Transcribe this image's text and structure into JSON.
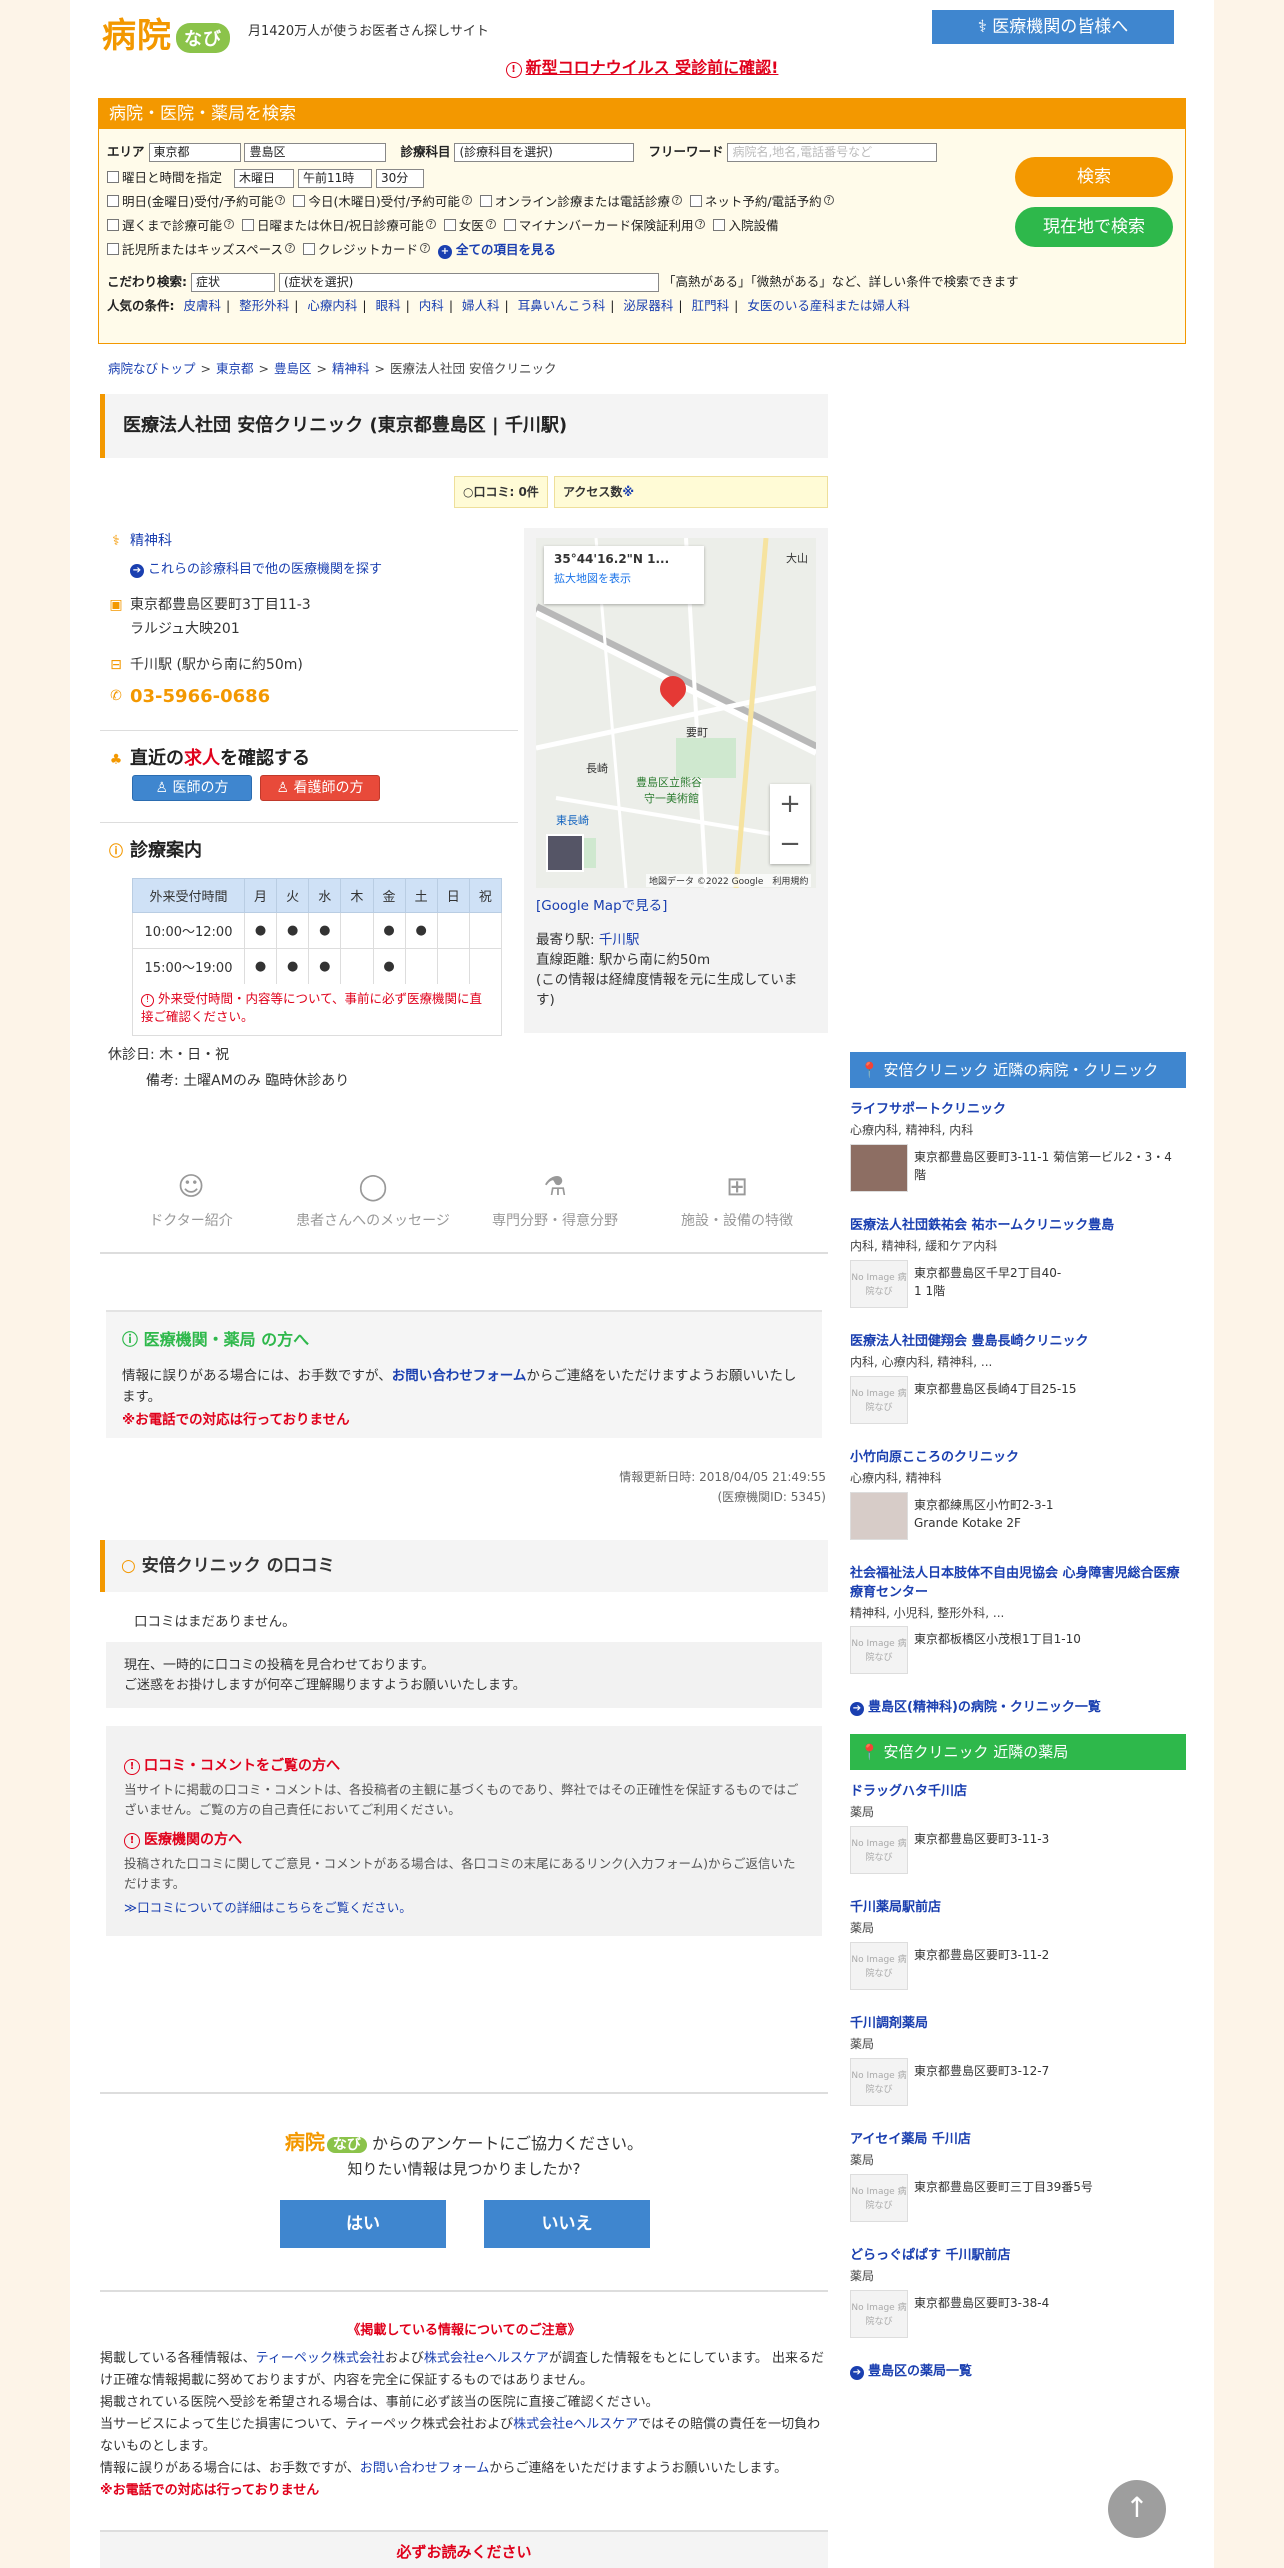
{
  "header": {
    "logo_main": "病院",
    "logo_sub": "なび",
    "tagline": "月1420万人が使うお医者さん探しサイト",
    "medical_btn": "医療機関の皆様へ",
    "covid_notice": "新型コロナウイルス 受診前に確認!"
  },
  "search": {
    "title": "病院・医院・薬局を検索",
    "area_label": "エリア",
    "pref": "東京都",
    "city": "豊島区",
    "dept_label": "診療科目",
    "dept": "(診療科目を選択)",
    "kw_label": "フリーワード",
    "kw_placeholder": "病院名,地名,電話番号など",
    "day_time_label": "曜日と時間を指定",
    "day": "木曜日",
    "hour": "午前11時",
    "minute": "30分",
    "checks": [
      "明日(金曜日)受付/予約可能",
      "今日(木曜日)受付/予約可能",
      "オンライン診療または電話診療",
      "ネット予約/電話予約",
      "遅くまで診療可能",
      "日曜または休日/祝日診療可能",
      "女医",
      "マイナンバーカード保険証利用",
      "入院設備",
      "託児所またはキッズスペース",
      "クレジットカード"
    ],
    "all_items": "全ての項目を見る",
    "kodawari_label": "こだわり検索:",
    "kodawari_type": "症状",
    "kodawari_sel": "(症状を選択)",
    "kodawari_hint": "「高熱がある」「微熱がある」など、詳しい条件で検索できます",
    "popular_label": "人気の条件:",
    "popular": [
      "皮膚科",
      "整形外科",
      "心療内科",
      "眼科",
      "内科",
      "婦人科",
      "耳鼻いんこう科",
      "泌尿器科",
      "肛門科",
      "女医のいる産科または婦人科"
    ],
    "search_btn": "検索",
    "here_btn": "現在地で検索"
  },
  "breadcrumb": [
    "病院なびトップ",
    "東京都",
    "豊島区",
    "精神科",
    "医療法人社団 安倍クリニック"
  ],
  "clinic": {
    "title": "医療法人社団 安倍クリニック (東京都豊島区 | 千川駅)",
    "reviews_badge": "口コミ: 0件",
    "access_badge": "アクセス数",
    "dept": "精神科",
    "other_link": "これらの診療科目で他の医療機関を探す",
    "address1": "東京都豊島区要町3丁目11-3",
    "address2": "ラルジュ大映201",
    "station": "千川駅 (駅から南に約50m)",
    "tel": "03-5966-0686",
    "job_pre": "直近の",
    "job_em": "求人",
    "job_post": "を確認する",
    "doctor_btn": "医師の方",
    "nurse_btn": "看護師の方",
    "schedule_title": "診療案内",
    "closed": "休診日: 木・日・祝",
    "remarks": "備考: 土曜AMのみ 臨時休診あり",
    "schedule_note": "外来受付時間・内容等について、事前に必ず医療機関に直接ご確認ください。"
  },
  "schedule": {
    "header": [
      "外来受付時間",
      "月",
      "火",
      "水",
      "木",
      "金",
      "土",
      "日",
      "祝"
    ],
    "rows": [
      [
        "10:00～12:00",
        "●",
        "●",
        "●",
        "",
        "●",
        "●",
        "",
        ""
      ],
      [
        "15:00～19:00",
        "●",
        "●",
        "●",
        "",
        "●",
        "",
        "",
        ""
      ]
    ]
  },
  "map": {
    "coord": "35°44'16.2\"N 1...",
    "enlarge": "拡大地図を表示",
    "google_link": "[Google Mapで見る]",
    "nearest_label": "最寄り駅:",
    "nearest_station": "千川駅",
    "distance": "直線距離: 駅から南に約50m",
    "disclaimer": "(この情報は経緯度情報を元に生成しています)",
    "labels": [
      "要町",
      "長崎",
      "豊島区立熊谷",
      "守一美術館",
      "東長崎",
      "大山"
    ],
    "footer": "地図データ ©2022 Google　利用規約"
  },
  "tabs": [
    "ドクター紹介",
    "患者さんへのメッセージ",
    "専門分野・得意分野",
    "施設・設備の特徴"
  ],
  "notice": {
    "title": "医療機関・薬局 の方へ",
    "text_pre": "情報に誤りがある場合には、お手数ですが、",
    "form": "お問い合わせフォーム",
    "text_post": "からご連絡をいただけますようお願いいたします。",
    "warn": "※お電話での対応は行っておりません"
  },
  "updated": "情報更新日時: 2018/04/05 21:49:55",
  "facility_id": "(医療機関ID: 5345)",
  "reviews": {
    "title": "安倍クリニック の口コミ",
    "none": "口コミはまだありません。",
    "suspend1": "現在、一時的に口コミの投稿を見合わせております。",
    "suspend2": "ご迷惑をお掛けしますが何卒ご理解賜りますようお願いいたします。",
    "h1": "口コミ・コメントをご覧の方へ",
    "t1": "当サイトに掲載の口コミ・コメントは、各投稿者の主観に基づくものであり、弊社ではその正確性を保証するものではございません。ご覧の方の自己責任においてご利用ください。",
    "h2": "医療機関の方へ",
    "t2": "投稿された口コミに関してご意見・コメントがある場合は、各口コミの末尾にあるリンク(入力フォーム)からご返信いただけます。",
    "link": "≫口コミについての詳細はこちらをご覧ください。"
  },
  "survey": {
    "title": "からのアンケートにご協力ください。",
    "question": "知りたい情報は見つかりましたか?",
    "yes": "はい",
    "no": "いいえ"
  },
  "footer": {
    "title": "《掲載している情報についてのご注意》",
    "l1_pre": "掲載している各種情報は、",
    "l1_c1": "ティーペック株式会社",
    "l1_and": "および",
    "l1_c2": "株式会社eヘルスケア",
    "l1_post": "が調査した情報をもとにしています。 出来るだけ正確な情報掲載に努めておりますが、内容を完全に保証するものではありません。",
    "l2": "掲載されている医院へ受診を希望される場合は、事前に必ず該当の医院に直接ご確認ください。",
    "l3_pre": "当サービスによって生じた損害について、ティーペック株式会社および",
    "l3_c": "株式会社eヘルスケア",
    "l3_post": "ではその賠償の責任を一切負わないものとします。",
    "l4_pre": "情報に誤りがある場合には、お手数ですが、",
    "l4_link": "お問い合わせフォーム",
    "l4_post": "からご連絡をいただけますようお願いいたします。",
    "warn": "※お電話での対応は行っておりません",
    "must_read": "必ずお読みください"
  },
  "nearby_clinics": {
    "title": "安倍クリニック 近隣の病院・クリニック",
    "items": [
      {
        "name": "ライフサポートクリニック",
        "cat": "心療内科, 精神科, 内科",
        "addr": "東京都豊島区要町3-11-1 菊信第一ビル2・3・4階"
      },
      {
        "name": "医療法人社団鉄祐会 祐ホームクリニック豊島",
        "cat": "内科, 精神科, 緩和ケア内科",
        "addr": "東京都豊島区千早2丁目40-1 1階"
      },
      {
        "name": "医療法人社団健翔会 豊島長崎クリニック",
        "cat": "内科, 心療内科, 精神科, ...",
        "addr": "東京都豊島区長崎4丁目25-15"
      },
      {
        "name": "小竹向原こころのクリニック",
        "cat": "心療内科, 精神科",
        "addr": "東京都練馬区小竹町2-3-1 Grande Kotake 2F"
      },
      {
        "name": "社会福祉法人日本肢体不自由児協会 心身障害児総合医療療育センター",
        "cat": "精神科, 小児科, 整形外科, ...",
        "addr": "東京都板橋区小茂根1丁目1-10"
      }
    ],
    "more": "豊島区(精神科)の病院・クリニック一覧"
  },
  "nearby_pharmacies": {
    "title": "安倍クリニック 近隣の薬局",
    "items": [
      {
        "name": "ドラッグハタ千川店",
        "cat": "薬局",
        "addr": "東京都豊島区要町3-11-3"
      },
      {
        "name": "千川薬局駅前店",
        "cat": "薬局",
        "addr": "東京都豊島区要町3-11-2"
      },
      {
        "name": "千川調剤薬局",
        "cat": "薬局",
        "addr": "東京都豊島区要町3-12-7"
      },
      {
        "name": "アイセイ薬局 千川店",
        "cat": "薬局",
        "addr": "東京都豊島区要町三丁目39番5号"
      },
      {
        "name": "どらっぐぱぱす 千川駅前店",
        "cat": "薬局",
        "addr": "東京都豊島区要町3-38-4"
      }
    ],
    "more": "豊島区の薬局一覧"
  },
  "no_image": "No Image 病院なび",
  "colors": {
    "brand": "#f39800",
    "blue": "#3f86cf",
    "green": "#2eb84b",
    "red": "#e0001b"
  }
}
